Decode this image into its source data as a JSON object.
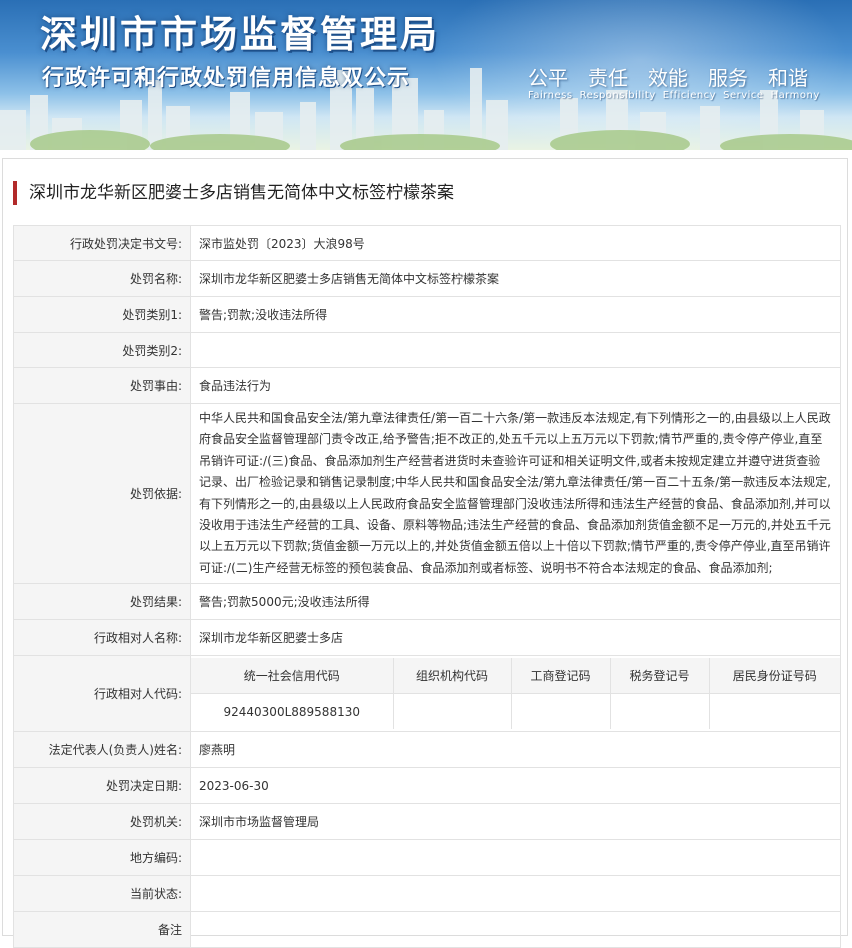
{
  "banner": {
    "title": "深圳市市场监督管理局",
    "subtitle": "行政许可和行政处罚信用信息双公示",
    "slogan_cn": [
      "公平",
      "责任",
      "效能",
      "服务",
      "和谐"
    ],
    "slogan_en": [
      "Fairness",
      "Responsibility",
      "Efficiency",
      "Service",
      "Harmony"
    ]
  },
  "page_title": "深圳市龙华新区肥婆士多店销售无简体中文标签柠檬茶案",
  "fields": {
    "doc_no": {
      "label": "行政处罚决定书文号:",
      "value": "深市监处罚〔2023〕大浪98号"
    },
    "case_name": {
      "label": "处罚名称:",
      "value": "深圳市龙华新区肥婆士多店销售无简体中文标签柠檬茶案"
    },
    "type1": {
      "label": "处罚类别1:",
      "value": "警告;罚款;没收违法所得"
    },
    "type2": {
      "label": "处罚类别2:",
      "value": ""
    },
    "reason": {
      "label": "处罚事由:",
      "value": "食品违法行为"
    },
    "basis": {
      "label": "处罚依据:",
      "value": "中华人民共和国食品安全法/第九章法律责任/第一百二十六条/第一款违反本法规定,有下列情形之一的,由县级以上人民政府食品安全监督管理部门责令改正,给予警告;拒不改正的,处五千元以上五万元以下罚款;情节严重的,责令停产停业,直至吊销许可证:/(三)食品、食品添加剂生产经营者进货时未查验许可证和相关证明文件,或者未按规定建立并遵守进货查验记录、出厂检验记录和销售记录制度;中华人民共和国食品安全法/第九章法律责任/第一百二十五条/第一款违反本法规定,有下列情形之一的,由县级以上人民政府食品安全监督管理部门没收违法所得和违法生产经营的食品、食品添加剂,并可以没收用于违法生产经营的工具、设备、原料等物品;违法生产经营的食品、食品添加剂货值金额不足一万元的,并处五千元以上五万元以下罚款;货值金额一万元以上的,并处货值金额五倍以上十倍以下罚款;情节严重的,责令停产停业,直至吊销许可证:/(二)生产经营无标签的预包装食品、食品添加剂或者标签、说明书不符合本法规定的食品、食品添加剂;"
    },
    "result": {
      "label": "处罚结果:",
      "value": "警告;罚款5000元;没收违法所得"
    },
    "party_name": {
      "label": "行政相对人名称:",
      "value": "深圳市龙华新区肥婆士多店"
    },
    "party_code": {
      "label": "行政相对人代码:",
      "headers": [
        "统一社会信用代码",
        "组织机构代码",
        "工商登记码",
        "税务登记号",
        "居民身份证号码"
      ],
      "values": [
        "92440300L889588130",
        "",
        "",
        "",
        ""
      ]
    },
    "legal_rep": {
      "label": "法定代表人(负责人)姓名:",
      "value": "廖燕明"
    },
    "decision_date": {
      "label": "处罚决定日期:",
      "value": "2023-06-30"
    },
    "authority": {
      "label": "处罚机关:",
      "value": "深圳市市场监督管理局"
    },
    "area_code": {
      "label": "地方编码:",
      "value": ""
    },
    "status": {
      "label": "当前状态:",
      "value": ""
    },
    "remark": {
      "label": "备注",
      "value": ""
    }
  },
  "colors": {
    "title_bar": "#b22a2a",
    "label_bg": "#f5f5f5",
    "border": "#e2e2e2",
    "banner_blue": "#2a6fb5"
  }
}
